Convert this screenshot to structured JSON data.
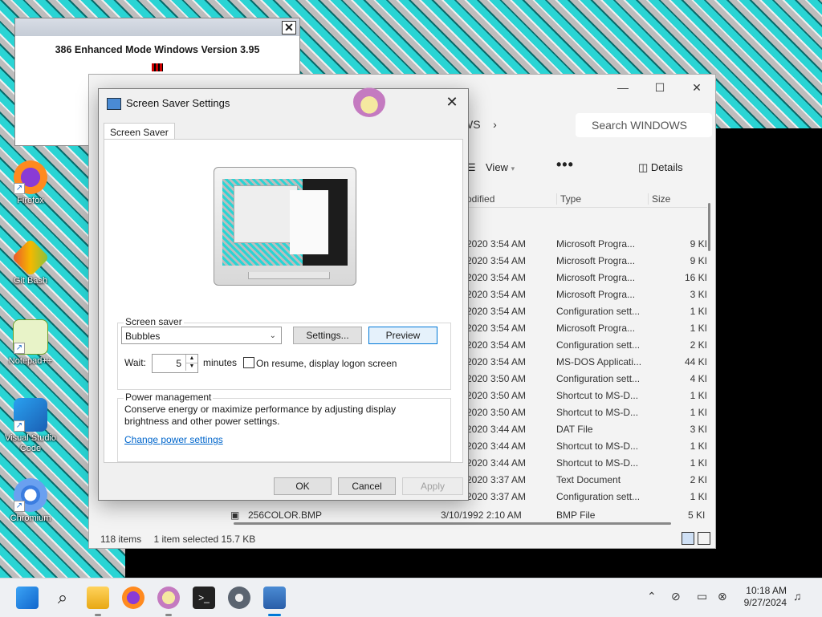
{
  "desktop": {
    "icons": [
      {
        "label": "Firefox"
      },
      {
        "label": "Git Bash"
      },
      {
        "label": "Notepad++"
      },
      {
        "label": "Visual Studio Code"
      },
      {
        "label": "Chromium"
      }
    ]
  },
  "win386": {
    "title": "386 Enhanced Mode Windows Version 3.95",
    "close": "✕"
  },
  "explorer": {
    "address_tail": "WS",
    "address_chevron": "›",
    "search_placeholder": "Search WINDOWS",
    "view_label": "View",
    "more_label": "•••",
    "details_label": "Details",
    "columns": {
      "modified": "odified",
      "type": "Type",
      "size": "Size"
    },
    "rows": [
      {
        "date": "2020 3:54 AM",
        "type": "Microsoft Progra...",
        "size": "9 KI"
      },
      {
        "date": "2020 3:54 AM",
        "type": "Microsoft Progra...",
        "size": "9 KI"
      },
      {
        "date": "2020 3:54 AM",
        "type": "Microsoft Progra...",
        "size": "16 KI"
      },
      {
        "date": "2020 3:54 AM",
        "type": "Microsoft Progra...",
        "size": "3 KI"
      },
      {
        "date": "2020 3:54 AM",
        "type": "Configuration sett...",
        "size": "1 KI"
      },
      {
        "date": "2020 3:54 AM",
        "type": "Microsoft Progra...",
        "size": "1 KI"
      },
      {
        "date": "2020 3:54 AM",
        "type": "Configuration sett...",
        "size": "2 KI"
      },
      {
        "date": "2020 3:54 AM",
        "type": "MS-DOS Applicati...",
        "size": "44 KI"
      },
      {
        "date": "2020 3:50 AM",
        "type": "Configuration sett...",
        "size": "4 KI"
      },
      {
        "date": "2020 3:50 AM",
        "type": "Shortcut to MS-D...",
        "size": "1 KI"
      },
      {
        "date": "2020 3:50 AM",
        "type": "Shortcut to MS-D...",
        "size": "1 KI"
      },
      {
        "date": "2020 3:44 AM",
        "type": "DAT File",
        "size": "3 KI"
      },
      {
        "date": "2020 3:44 AM",
        "type": "Shortcut to MS-D...",
        "size": "1 KI"
      },
      {
        "date": "2020 3:44 AM",
        "type": "Shortcut to MS-D...",
        "size": "1 KI"
      },
      {
        "date": "2020 3:37 AM",
        "type": "Text Document",
        "size": "2 KI"
      },
      {
        "date": "2020 3:37 AM",
        "type": "Configuration sett...",
        "size": "1 KI"
      }
    ],
    "bmp_row": {
      "name": "256COLOR.BMP",
      "date": "3/10/1992 2:10 AM",
      "type": "BMP File",
      "size": "5 KI"
    },
    "status": {
      "items": "118 items",
      "selected": "1 item selected  15.7 KB"
    }
  },
  "dialog": {
    "title": "Screen Saver Settings",
    "close": "✕",
    "tab": "Screen Saver",
    "screensaver_group": "Screen saver",
    "screensaver_value": "Bubbles",
    "settings_button": "Settings...",
    "preview_button": "Preview",
    "wait_label": "Wait:",
    "wait_value": "5",
    "minutes_label": "minutes",
    "resume_label": "On resume, display logon screen",
    "power_group": "Power management",
    "power_text": "Conserve energy or maximize performance by adjusting display brightness and other power settings.",
    "power_link": "Change power settings",
    "ok": "OK",
    "cancel": "Cancel",
    "apply": "Apply"
  },
  "taskbar": {
    "time": "10:18 AM",
    "date": "9/27/2024"
  },
  "colors": {
    "accent": "#0078d7",
    "wallpaper_cyan": "#2ad4d4",
    "link": "#0066cc"
  }
}
